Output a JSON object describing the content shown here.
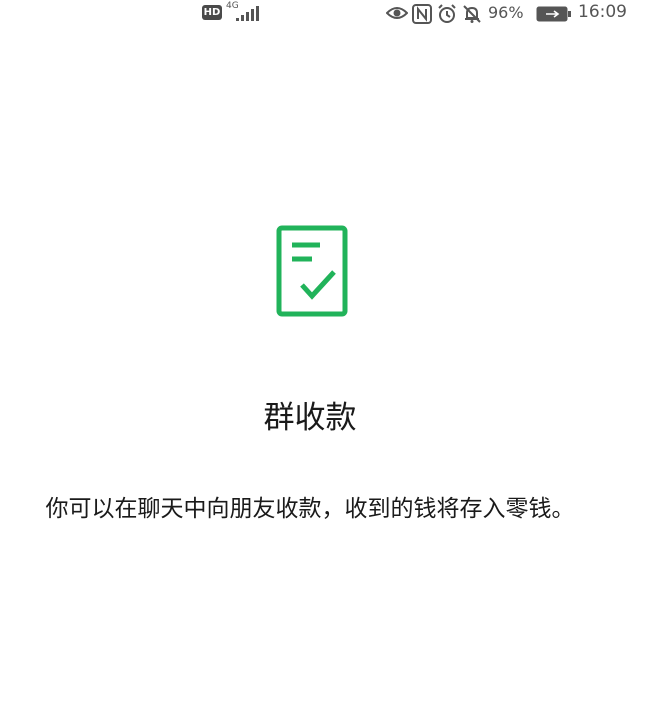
{
  "status_bar": {
    "hd_label": "HD",
    "network_type": "4G",
    "signal_icon": "signal-bars-icon",
    "eye_icon": "eye-icon",
    "nfc_icon": "nfc-icon",
    "alarm_icon": "alarm-clock-icon",
    "notifications_icon": "bell-off-icon",
    "battery_percent": "96%",
    "battery_icon": "battery-charging-icon",
    "time": "16:09"
  },
  "feature": {
    "icon": "receipt-check-icon",
    "title": "群收款",
    "description": "你可以在聊天中向朋友收款，收到的钱将存入零钱。"
  },
  "colors": {
    "accent_green": "#21b35a",
    "text_primary": "#1a1a1a",
    "status_text": "#555555",
    "background": "#ffffff"
  }
}
